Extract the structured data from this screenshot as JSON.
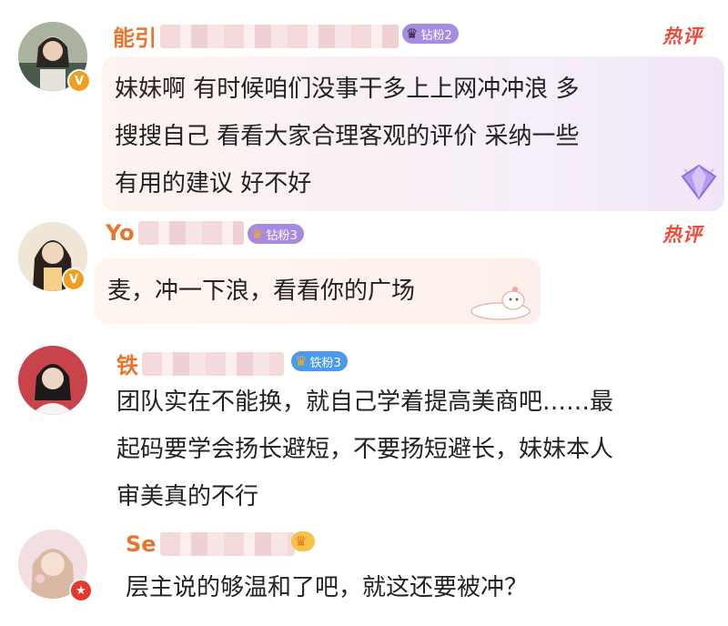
{
  "comments": [
    {
      "user_prefix": "能引",
      "fan_badge": "钻粉2",
      "hot_label": "热评",
      "text_lines": [
        "妹妹啊 有时候咱们没事干多上上网冲冲浪 多",
        "搜搜自己 看看大家合理客观的评价 采纳一些",
        "有用的建议 好不好"
      ]
    },
    {
      "user_prefix": "Yo",
      "fan_badge": "钻粉3",
      "hot_label": "热评",
      "text_lines": [
        "麦，冲一下浪，看看你的广场"
      ]
    },
    {
      "user_prefix": "铁",
      "fan_badge": "铁粉3",
      "text_lines": [
        "团队实在不能换，就自己学着提高美商吧……最",
        "起码要学会扬长避短，不要扬短避长，妹妹本人",
        "审美真的不行"
      ]
    },
    {
      "user_prefix": "Se",
      "text_lines": [
        "层主说的够温和了吧，就这还要被冲？"
      ]
    }
  ],
  "colors": {
    "username": "#e8752b",
    "hot": "#f04a3a",
    "diamond_badge": "#9b7be8",
    "iron_badge": "#4b9be8",
    "verified_gold": "#f0a020",
    "verified_red": "#e23b2e"
  }
}
